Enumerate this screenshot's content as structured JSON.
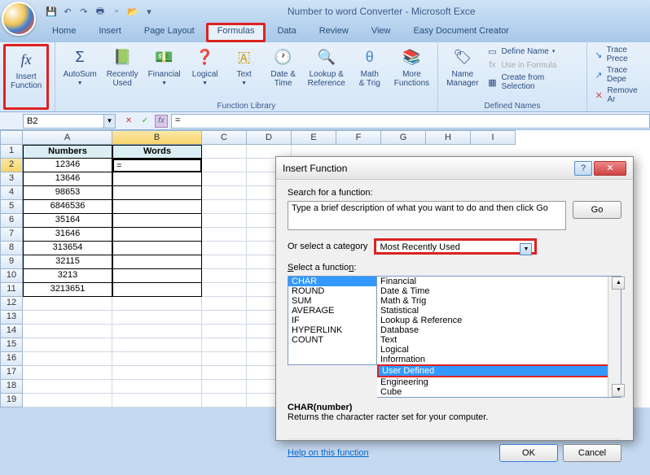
{
  "app": {
    "title": "Number to word Converter - Microsoft Exce"
  },
  "tabs": {
    "home": "Home",
    "insert": "Insert",
    "page_layout": "Page Layout",
    "formulas": "Formulas",
    "data": "Data",
    "review": "Review",
    "view": "View",
    "easy_doc": "Easy Document Creator"
  },
  "ribbon": {
    "insert_function": "Insert\nFunction",
    "autosum": "AutoSum",
    "recently_used": "Recently\nUsed",
    "financial": "Financial",
    "logical": "Logical",
    "text": "Text",
    "date_time": "Date &\nTime",
    "lookup_ref": "Lookup &\nReference",
    "math_trig": "Math\n& Trig",
    "more_funcs": "More\nFunctions",
    "function_library": "Function Library",
    "name_manager": "Name\nManager",
    "define_name": "Define Name",
    "use_in_formula": "Use in Formula",
    "create_selection": "Create from Selection",
    "defined_names": "Defined Names",
    "trace_prec": "Trace Prece",
    "trace_dep": "Trace Depe",
    "remove_ar": "Remove Ar"
  },
  "formula_bar": {
    "cell_ref": "B2",
    "formula": "="
  },
  "columns": [
    "A",
    "B",
    "C",
    "D",
    "E",
    "F",
    "G",
    "H",
    "I"
  ],
  "headers": {
    "a": "Numbers",
    "b": "Words"
  },
  "cells": {
    "a2": "12346",
    "b2": "=",
    "a3": "13646",
    "a4": "98653",
    "a5": "6846536",
    "a6": "35164",
    "a7": "31646",
    "a8": "313654",
    "a9": "32115",
    "a10": "3213",
    "a11": "3213651"
  },
  "dialog": {
    "title": "Insert Function",
    "search_label": "Search for a function:",
    "search_placeholder": "Type a brief description of what you want to do and then click Go",
    "go": "Go",
    "category_label": "Or select a category",
    "category_value": "Most Recently Used",
    "select_func_label": "Select a function:",
    "functions": [
      "CHAR",
      "ROUND",
      "SUM",
      "AVERAGE",
      "IF",
      "HYPERLINK",
      "COUNT"
    ],
    "categories": [
      "Financial",
      "Date & Time",
      "Math & Trig",
      "Statistical",
      "Lookup & Reference",
      "Database",
      "Text",
      "Logical",
      "Information",
      "User Defined",
      "Engineering",
      "Cube"
    ],
    "desc_name": "CHAR(number)",
    "desc_text": "Returns the character                                                              racter set for your computer.",
    "help_link": "Help on this function",
    "ok": "OK",
    "cancel": "Cancel"
  }
}
